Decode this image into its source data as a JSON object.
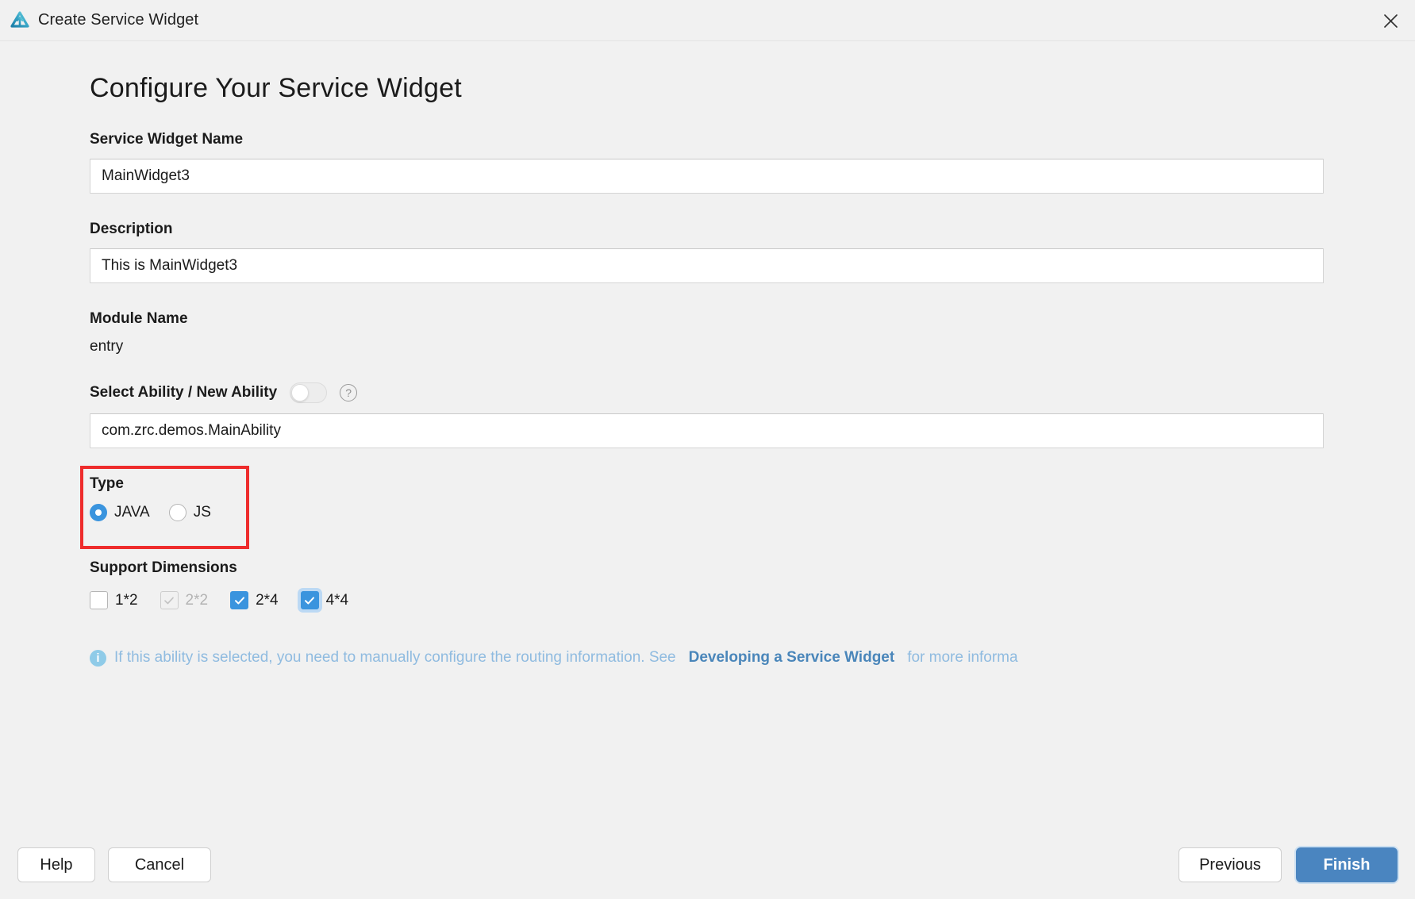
{
  "window": {
    "title": "Create Service Widget",
    "logo_icon": "huawei-devstudio-logo-icon",
    "close_icon": "close-icon"
  },
  "page": {
    "heading": "Configure Your Service Widget"
  },
  "fields": {
    "widget_name": {
      "label": "Service Widget Name",
      "value": "MainWidget3",
      "placeholder": "Service Widget Name"
    },
    "description": {
      "label": "Description",
      "value": "This is MainWidget3",
      "placeholder": "Description"
    },
    "module_name": {
      "label": "Module Name",
      "value": "entry"
    },
    "ability": {
      "label": "Select Ability / New Ability",
      "toggle_state": "off",
      "help_icon": "question-mark-icon",
      "value": "com.zrc.demos.MainAbility",
      "placeholder": "Ability name"
    }
  },
  "type_group": {
    "label": "Type",
    "highlighted": true,
    "highlight_color": "#ee2c2c",
    "selected": "JAVA",
    "options": [
      {
        "label": "JAVA",
        "checked": true
      },
      {
        "label": "JS",
        "checked": false
      }
    ]
  },
  "support_dimensions": {
    "label": "Support Dimensions",
    "options": [
      {
        "label": "1*2",
        "checked": false,
        "disabled": false,
        "focused": false
      },
      {
        "label": "2*2",
        "checked": true,
        "disabled": true,
        "focused": false
      },
      {
        "label": "2*4",
        "checked": true,
        "disabled": false,
        "focused": false
      },
      {
        "label": "4*4",
        "checked": true,
        "disabled": false,
        "focused": true
      }
    ]
  },
  "note": {
    "icon": "info-icon",
    "text_before": "If this ability is selected, you need to manually configure the routing information. See",
    "link_text": "Developing a Service Widget",
    "text_after": "for more informa"
  },
  "footer": {
    "help_label": "Help",
    "cancel_label": "Cancel",
    "previous_label": "Previous",
    "finish_label": "Finish"
  },
  "colors": {
    "accent": "#3a94de",
    "primary_button": "#4a85c0",
    "highlight": "#ee2c2c",
    "link": "#4a86ba",
    "note_text": "#8fbbe0"
  }
}
